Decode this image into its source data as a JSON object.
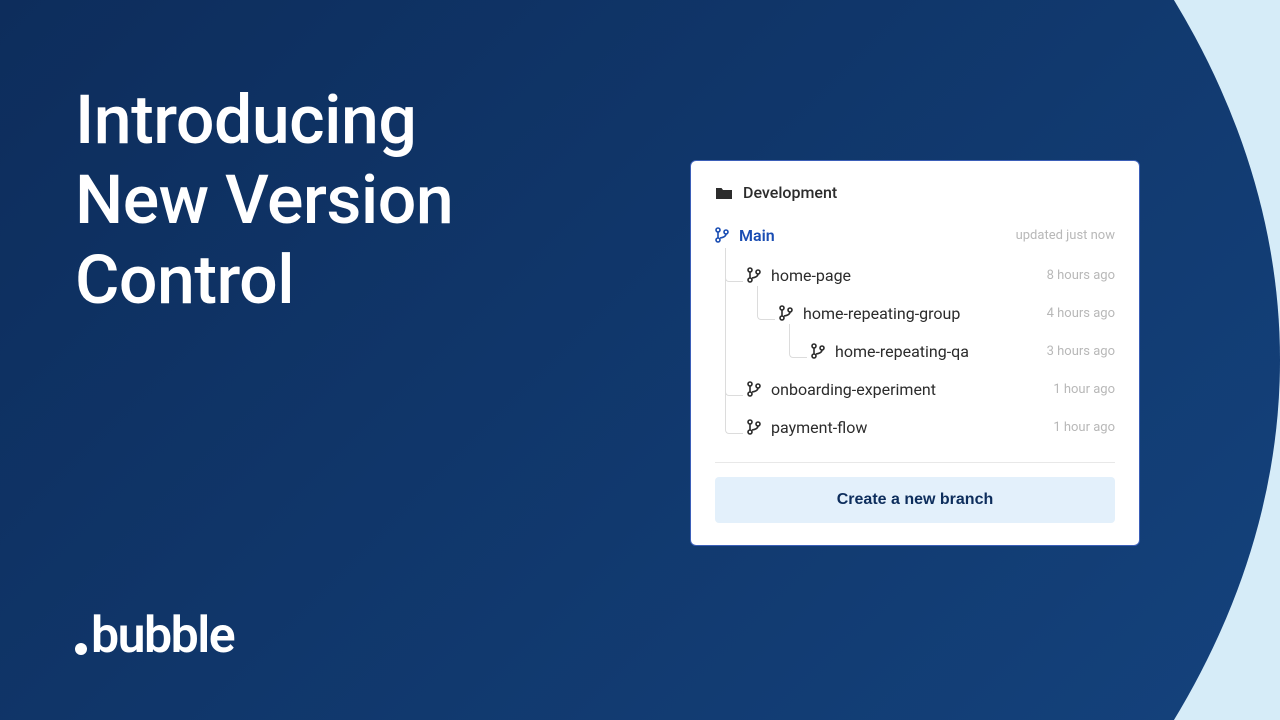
{
  "heading": {
    "line1": "Introducing",
    "line2": "New Version",
    "line3": "Control"
  },
  "logo": {
    "text": "bubble"
  },
  "panel": {
    "folder_label": "Development",
    "main_branch": {
      "name": "Main",
      "time": "updated just now"
    },
    "branches": [
      {
        "name": "home-page",
        "time": "8 hours ago",
        "indent": 1
      },
      {
        "name": "home-repeating-group",
        "time": "4 hours ago",
        "indent": 2
      },
      {
        "name": "home-repeating-qa",
        "time": "3 hours ago",
        "indent": 3
      },
      {
        "name": "onboarding-experiment",
        "time": "1 hour ago",
        "indent": 1
      },
      {
        "name": "payment-flow",
        "time": "1 hour ago",
        "indent": 1
      }
    ],
    "create_button": "Create a new branch"
  },
  "colors": {
    "accent": "#1a4db3",
    "dark_bg": "#0d2d5c",
    "light_bg": "#d6ecf8"
  }
}
